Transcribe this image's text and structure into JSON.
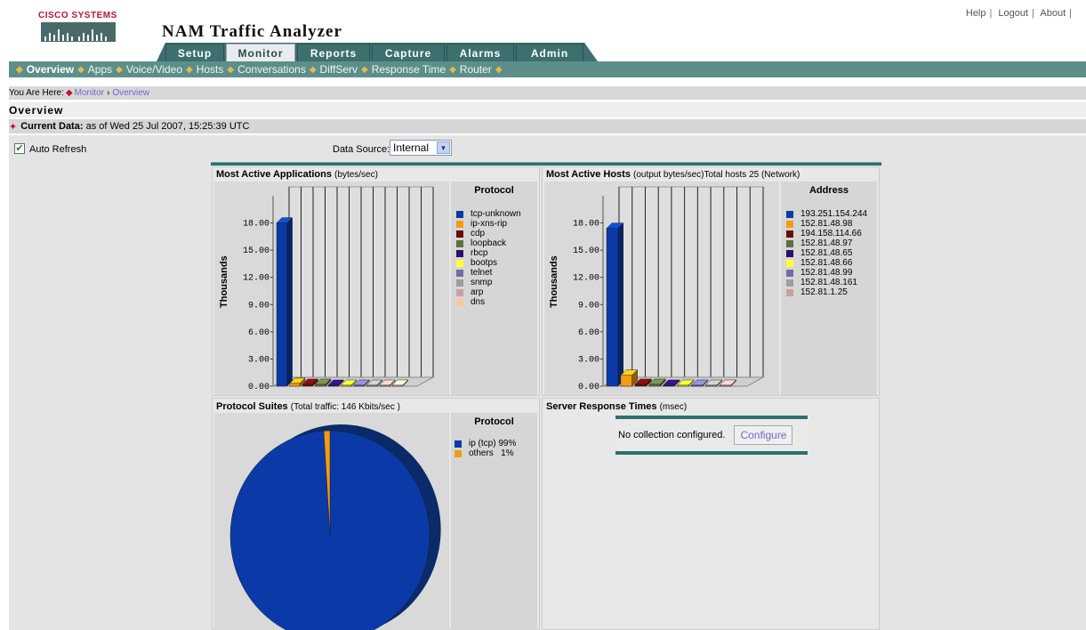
{
  "header": {
    "logo_text": "Cisco Systems",
    "app_title": "NAM Traffic Analyzer",
    "links": [
      "Help",
      "Logout",
      "About"
    ],
    "tabs": [
      {
        "label": "Setup",
        "active": false
      },
      {
        "label": "Monitor",
        "active": true
      },
      {
        "label": "Reports",
        "active": false
      },
      {
        "label": "Capture",
        "active": false
      },
      {
        "label": "Alarms",
        "active": false
      },
      {
        "label": "Admin",
        "active": false
      }
    ]
  },
  "subnav": [
    "Overview",
    "Apps",
    "Voice/Video",
    "Hosts",
    "Conversations",
    "DiffServ",
    "Response Time",
    "Router"
  ],
  "breadcrumb": {
    "prefix": "You Are Here:",
    "items": [
      "Monitor",
      "Overview"
    ]
  },
  "page_title": "Overview",
  "current_data": {
    "label": "Current Data:",
    "value": "as of Wed 25 Jul 2007, 15:25:39 UTC"
  },
  "controls": {
    "auto_refresh_label": "Auto Refresh",
    "auto_refresh_checked": true,
    "data_source_label": "Data Source:",
    "data_source_value": "Internal"
  },
  "colors": {
    "teal": "#2e6e6e",
    "subnav": "#5c8f8a",
    "series": [
      "#0b3aa8",
      "#f39c12",
      "#6b0a0a",
      "#5f6f3a",
      "#2a0d6e",
      "#ffff33",
      "#6e6ea8",
      "#9e9e9e",
      "#c9a0a0",
      "#f7c79e"
    ]
  },
  "apps_chart": {
    "title": "Most Active Applications",
    "subtitle": "(bytes/sec)",
    "ylabel": "Thousands",
    "legend_head": "Protocol",
    "ticks": [
      "18.00",
      "15.00",
      "12.00",
      "9.00",
      "6.00",
      "3.00",
      "0.00"
    ]
  },
  "hosts_chart": {
    "title": "Most Active Hosts",
    "subtitle": "(output bytes/sec)Total hosts 25 (Network)",
    "ylabel": "Thousands",
    "legend_head": "Address",
    "ticks": [
      "18.00",
      "15.00",
      "12.00",
      "9.00",
      "6.00",
      "3.00",
      "0.00"
    ]
  },
  "suites_chart": {
    "title": "Protocol Suites",
    "subtitle": "(Total traffic: 146 Kbits/sec )",
    "legend_head": "Protocol",
    "legend": [
      "ip (tcp) 99%",
      "others   1%"
    ]
  },
  "srt": {
    "title": "Server Response Times",
    "subtitle": "(msec)",
    "message": "No collection configured.",
    "button": "Configure"
  },
  "chart_data": [
    {
      "type": "bar",
      "title": "Most Active Applications",
      "ylabel": "Thousands",
      "ylim": [
        0,
        21
      ],
      "categories": [
        "tcp-unknown",
        "ip-xns-rip",
        "cdp",
        "loopback",
        "rbcp",
        "bootps",
        "telnet",
        "snmp",
        "arp",
        "dns"
      ],
      "values": [
        18.0,
        0.3,
        0.2,
        0.2,
        0.1,
        0.1,
        0.1,
        0.1,
        0.1,
        0.1
      ]
    },
    {
      "type": "bar",
      "title": "Most Active Hosts",
      "ylabel": "Thousands",
      "ylim": [
        0,
        21
      ],
      "categories": [
        "193.251.154.244",
        "152.81.48.98",
        "194.158.114.66",
        "152.81.48.97",
        "152.81.48.65",
        "152.81.48.66",
        "152.81.48.99",
        "152.81.48.161",
        "152.81.1.25"
      ],
      "values": [
        17.4,
        1.2,
        0.2,
        0.2,
        0.1,
        0.1,
        0.1,
        0.1,
        0.1
      ]
    },
    {
      "type": "pie",
      "title": "Protocol Suites",
      "categories": [
        "ip (tcp)",
        "others"
      ],
      "values": [
        99,
        1
      ]
    }
  ]
}
